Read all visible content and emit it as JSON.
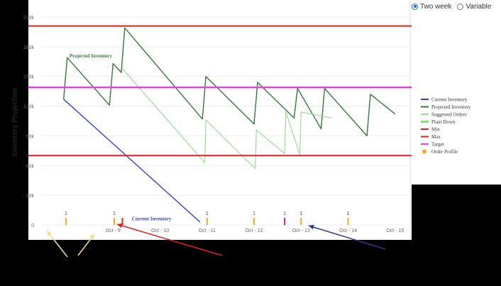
{
  "controls": {
    "options": [
      {
        "label": "Two week",
        "selected": true
      },
      {
        "label": "Variable",
        "selected": false
      }
    ]
  },
  "chart_data": {
    "type": "line",
    "title": "",
    "xlabel": "",
    "ylabel": "Inventory Projection",
    "ylim": [
      0,
      210000
    ],
    "y_ticks": [
      0,
      30000,
      60000,
      90000,
      120000,
      150000,
      180000,
      210000
    ],
    "y_tick_labels": [
      "0",
      "30k",
      "60k",
      "90k",
      "120k",
      "150k",
      "180k",
      "210k"
    ],
    "x_domain": [
      0,
      16.3
    ],
    "x_ticks": [
      {
        "x": 3.6,
        "label": "Oct - 9"
      },
      {
        "x": 5.6,
        "label": "Oct - 10"
      },
      {
        "x": 7.6,
        "label": "Oct - 11"
      },
      {
        "x": 9.6,
        "label": "Oct - 12"
      },
      {
        "x": 11.6,
        "label": "Oct - 13"
      },
      {
        "x": 13.6,
        "label": "Oct - 14"
      },
      {
        "x": 15.6,
        "label": "Oct - 15"
      }
    ],
    "grid": false,
    "legend_position": "right",
    "series": [
      {
        "name": "Current Inventory",
        "color": "#3344cc",
        "x": [
          1.5,
          7.3
        ],
        "y": [
          127000,
          3000
        ]
      },
      {
        "name": "Projected Inventory",
        "color": "#2e7d32",
        "x": [
          1.5,
          1.65,
          3.45,
          3.6,
          3.95,
          4.1,
          7.4,
          7.55,
          9.6,
          9.75,
          11.3,
          11.45,
          12.45,
          12.6,
          14.4,
          14.55,
          15.6
        ],
        "y": [
          127000,
          169000,
          121000,
          163000,
          154000,
          199000,
          107000,
          150000,
          102000,
          144000,
          108000,
          138000,
          97000,
          138000,
          90000,
          132000,
          112000
        ]
      },
      {
        "name": "Suggested Orders",
        "color": "#9fd89b",
        "x": [
          4.0,
          7.5,
          7.55,
          9.65,
          9.7,
          10.9,
          10.95,
          11.55,
          11.6,
          12.9
        ],
        "y": [
          158000,
          63000,
          106000,
          57000,
          96000,
          72000,
          114000,
          71000,
          114000,
          108000
        ]
      },
      {
        "name": "Plant Down",
        "color": "#44dd44",
        "x": [],
        "y": []
      },
      {
        "name": "Min",
        "color": "#dd2222",
        "x": [
          0,
          16.3
        ],
        "y": [
          70000,
          70000
        ]
      },
      {
        "name": "Max",
        "color": "#dd2222",
        "x": [
          0,
          16.3
        ],
        "y": [
          201000,
          201000
        ]
      },
      {
        "name": "Target",
        "color": "#dd44dd",
        "x": [
          0,
          16.3
        ],
        "y": [
          139000,
          139000
        ]
      },
      {
        "name": "Order Profile",
        "color": "#f5a623",
        "x": [],
        "y": []
      }
    ],
    "order_markers": [
      {
        "x": 1.6,
        "label": "1",
        "color": "#f5a623"
      },
      {
        "x": 3.65,
        "label": "1",
        "color": "#f5a623"
      },
      {
        "x": 4.0,
        "label": "",
        "color": "#dd2222"
      },
      {
        "x": 7.6,
        "label": "1",
        "color": "#f5a623"
      },
      {
        "x": 9.6,
        "label": "1",
        "color": "#f5a623"
      },
      {
        "x": 10.9,
        "label": "1",
        "color": "#cc2288"
      },
      {
        "x": 11.6,
        "label": "1",
        "color": "#f5a623"
      },
      {
        "x": 13.6,
        "label": "1",
        "color": "#f5a623"
      }
    ],
    "annotations": [
      {
        "text": "Projected Inventory",
        "x": 1.75,
        "y": 169000,
        "color": "#2e7d32"
      },
      {
        "text": "Current Inventory",
        "x": 4.4,
        "y": 4500,
        "color": "#3344cc"
      }
    ],
    "arrows": [
      {
        "color": "#f7e08a",
        "from": [
          95,
          362
        ],
        "to": [
          66,
          325
        ]
      },
      {
        "color": "#f7e08a",
        "from": [
          110,
          360
        ],
        "to": [
          133,
          330
        ]
      },
      {
        "color": "#e02020",
        "from": [
          313,
          360
        ],
        "to": [
          165,
          316
        ]
      },
      {
        "color": "#2b3a8e",
        "from": [
          543,
          351
        ],
        "to": [
          435,
          318
        ]
      }
    ]
  }
}
